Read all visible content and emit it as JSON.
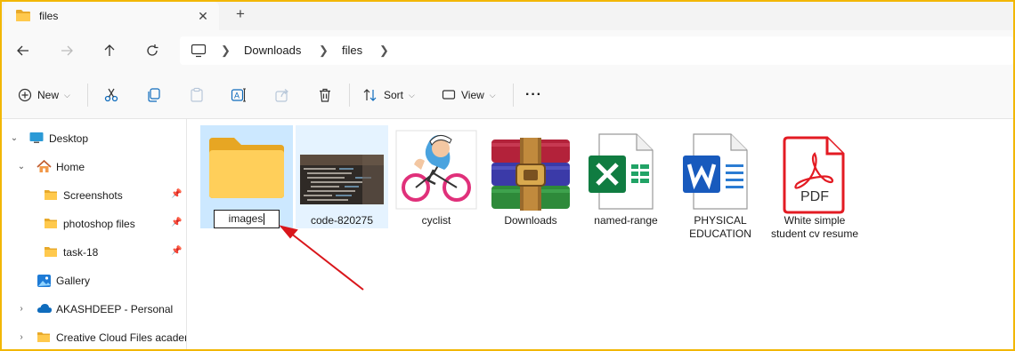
{
  "tab": {
    "title": "files",
    "close": "✕",
    "new": "+"
  },
  "nav": {
    "crumbs": [
      "Downloads",
      "files"
    ]
  },
  "toolbar": {
    "new_label": "New",
    "sort_label": "Sort",
    "view_label": "View",
    "more_label": "···"
  },
  "sidebar": {
    "items": [
      {
        "label": "Desktop"
      },
      {
        "label": "Home"
      },
      {
        "label": "Screenshots"
      },
      {
        "label": "photoshop files"
      },
      {
        "label": "task-18"
      },
      {
        "label": "Gallery"
      },
      {
        "label": "AKASHDEEP - Personal"
      },
      {
        "label": "Creative Cloud Files  acader"
      }
    ]
  },
  "files": [
    {
      "name": "images",
      "type": "folder",
      "renaming": true
    },
    {
      "name": "code-820275",
      "type": "image"
    },
    {
      "name": "cyclist",
      "type": "image"
    },
    {
      "name": "Downloads",
      "type": "winrar-archive"
    },
    {
      "name": "named-range",
      "type": "excel"
    },
    {
      "name": "PHYSICAL EDUCATION",
      "type": "word"
    },
    {
      "name": "White simple student cv resume",
      "type": "pdf",
      "badge": "PDF"
    }
  ],
  "colors": {
    "selection": "#cce8ff",
    "frame": "#f2b705",
    "annotation_arrow": "#d9161b"
  }
}
